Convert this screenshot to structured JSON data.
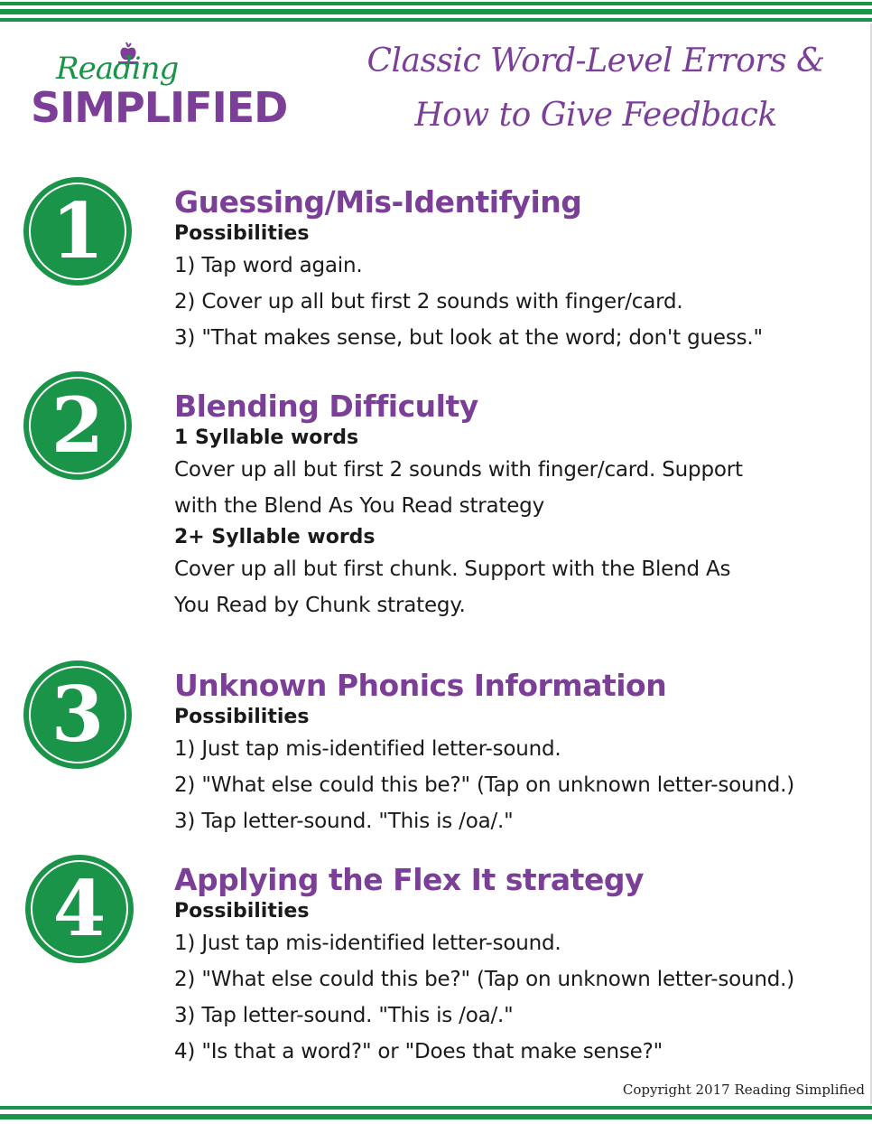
{
  "brand": {
    "logo_top": "Reading",
    "logo_bottom": "SIMPLIFIED",
    "colors": {
      "green": "#1a9448",
      "purple": "#7b3f98",
      "text": "#1a1a1a"
    }
  },
  "header": {
    "title_line1": "Classic Word-Level Errors &",
    "title_line2": "How to Give Feedback"
  },
  "sections": [
    {
      "number": "1",
      "title": "Guessing/Mis-Identifying",
      "subheading": "Possibilities",
      "lines": [
        "1) Tap word again.",
        "2) Cover up all but first 2 sounds with finger/card.",
        "3) \"That makes sense, but look at the word; don't guess.\""
      ]
    },
    {
      "number": "2",
      "title": "Blending Difficulty",
      "groups": [
        {
          "subheading": "1 Syllable words",
          "lines": [
            "Cover up all but first 2 sounds with finger/card. Support",
            "with the Blend As You Read strategy"
          ]
        },
        {
          "subheading": "2+ Syllable words",
          "lines": [
            "Cover up all but first chunk. Support with the Blend As",
            "You Read by Chunk strategy."
          ]
        }
      ]
    },
    {
      "number": "3",
      "title": "Unknown Phonics Information",
      "subheading": "Possibilities",
      "lines": [
        "1) Just tap mis-identified letter-sound.",
        "2) \"What else could this be?\" (Tap on unknown letter-sound.)",
        "3) Tap letter-sound. \"This is /oa/.\""
      ]
    },
    {
      "number": "4",
      "title": "Applying the Flex It strategy",
      "subheading": "Possibilities",
      "lines": [
        "1) Just tap mis-identified letter-sound.",
        "2) \"What else could this be?\" (Tap on unknown letter-sound.)",
        "3) Tap letter-sound. \"This is /oa/.\"",
        "4) \"Is that a word?\" or \"Does that make sense?\""
      ]
    }
  ],
  "footer": {
    "copyright": "Copyright 2017 Reading Simplified"
  }
}
